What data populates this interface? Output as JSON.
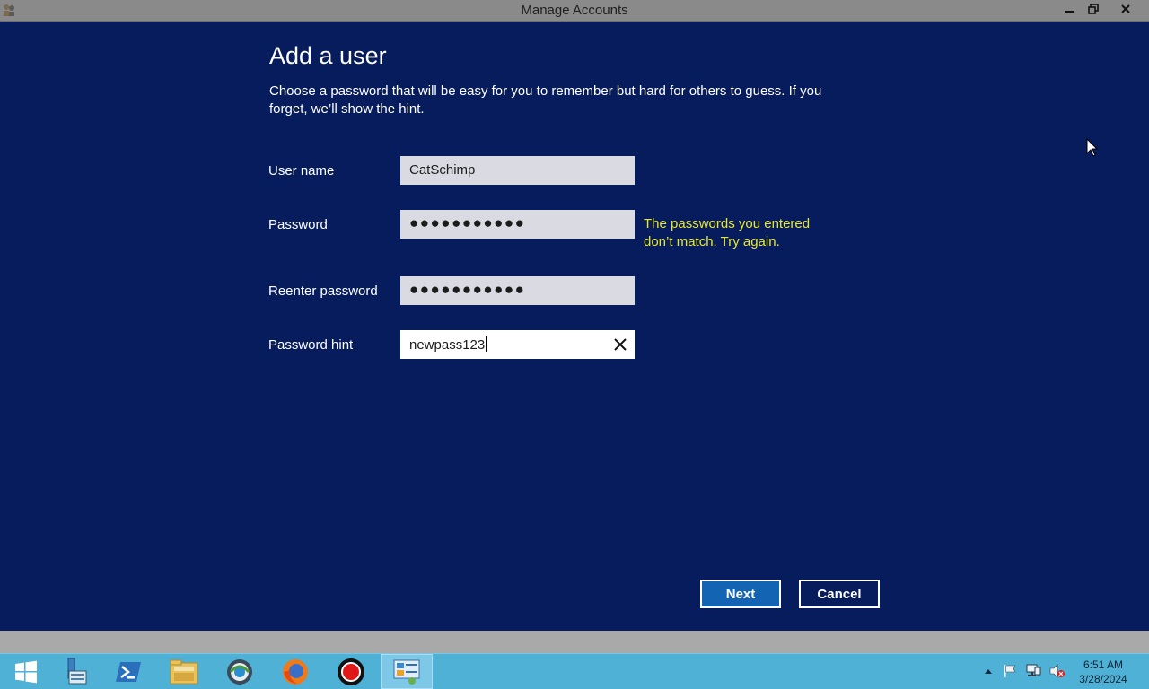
{
  "window": {
    "title": "Manage Accounts",
    "minimize_glyph": "▁",
    "restore_glyph": "❐",
    "close_glyph": "✕"
  },
  "dialog": {
    "heading": "Add a user",
    "instructions": "Choose a password that will be easy for you to remember but hard for others to guess. If you forget, we’ll show the hint.",
    "fields": {
      "username": {
        "label": "User name",
        "value": "CatSchimp"
      },
      "password": {
        "label": "Password",
        "value": "●●●●●●●●●●●"
      },
      "reenter": {
        "label": "Reenter password",
        "value": "●●●●●●●●●●●"
      },
      "hint": {
        "label": "Password hint",
        "value": "newpass123"
      }
    },
    "error": "The passwords you entered don’t match. Try again.",
    "buttons": {
      "next": "Next",
      "cancel": "Cancel"
    }
  },
  "taskbar": {
    "items": [
      {
        "name": "start-button",
        "icon": "windows-logo-icon"
      },
      {
        "name": "server-manager",
        "icon": "server-manager-icon"
      },
      {
        "name": "powershell",
        "icon": "powershell-icon"
      },
      {
        "name": "file-explorer",
        "icon": "folder-icon"
      },
      {
        "name": "network-tool",
        "icon": "globe-icon"
      },
      {
        "name": "firefox",
        "icon": "firefox-icon"
      },
      {
        "name": "recorder",
        "icon": "record-icon"
      },
      {
        "name": "control-panel",
        "icon": "control-panel-icon",
        "active": true
      }
    ],
    "clock": {
      "time": "6:51 AM",
      "date": "3/28/2024"
    }
  },
  "colors": {
    "background": "#061c5c",
    "error": "#e8e832",
    "next_button": "#1464b4",
    "taskbar": "#4fb1d5"
  }
}
